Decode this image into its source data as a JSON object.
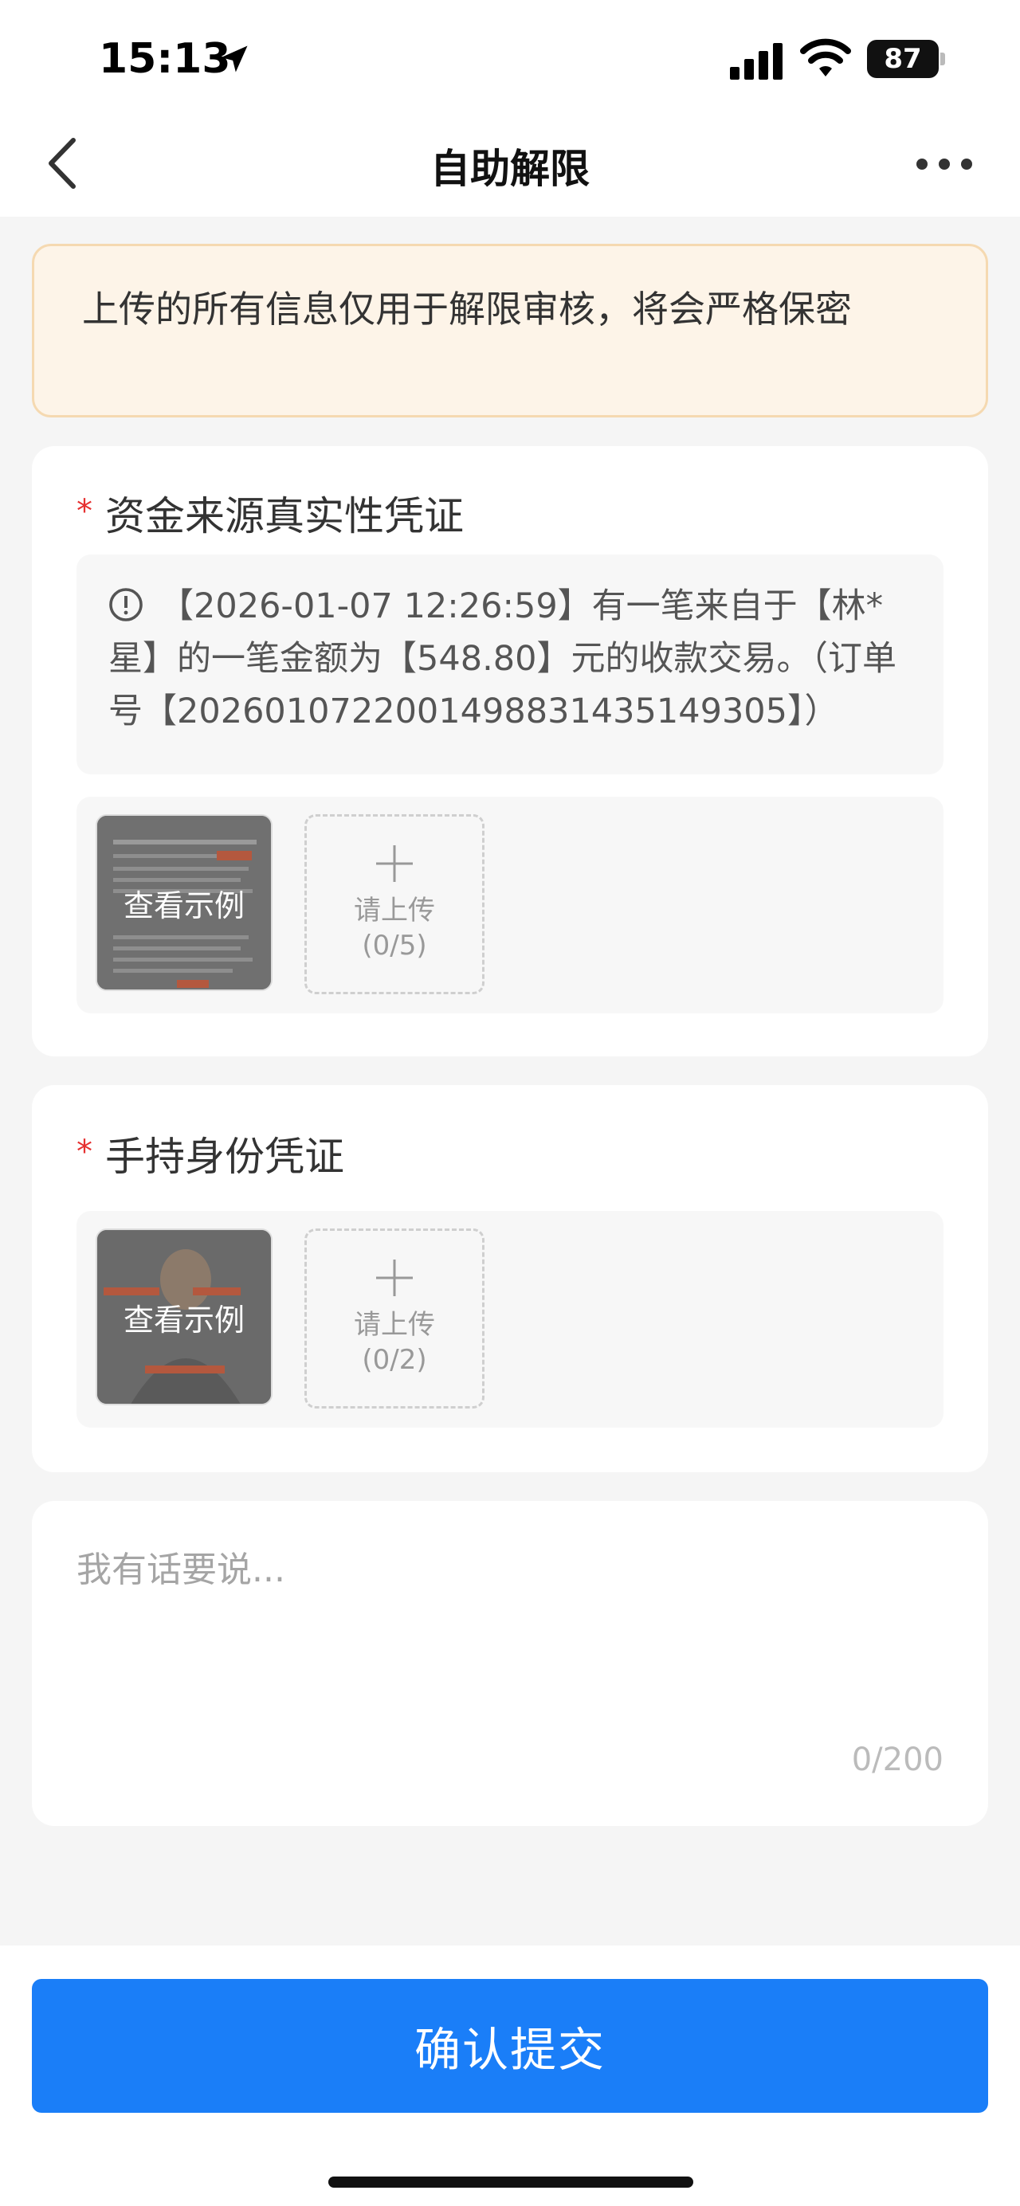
{
  "status_bar": {
    "time": "15:13",
    "battery": "87"
  },
  "nav": {
    "title": "自助解限"
  },
  "notice": {
    "text": "上传的所有信息仅用于解限审核，将会严格保密"
  },
  "fund_proof": {
    "title": "资金来源真实性凭证",
    "info": "【2026-01-07 12:26:59】有一笔来自于【林*星】的一笔金额为【548.80】元的收款交易。（订单号【2026010722001498831435149305】）",
    "example_label": "查看示例",
    "upload_label": "请上传",
    "upload_count": "(0/5)"
  },
  "id_proof": {
    "title": "手持身份凭证",
    "example_label": "查看示例",
    "upload_label": "请上传",
    "upload_count": "(0/2)"
  },
  "comment": {
    "placeholder": "我有话要说...",
    "count": "0/200"
  },
  "submit": {
    "label": "确认提交"
  },
  "colors": {
    "accent": "#1a7ef8",
    "notice_bg": "#fdf4e8",
    "required": "#e63030"
  },
  "icons": [
    "location-arrow-icon",
    "signal-icon",
    "wifi-icon",
    "back-icon",
    "more-icon",
    "info-icon",
    "plus-icon"
  ]
}
